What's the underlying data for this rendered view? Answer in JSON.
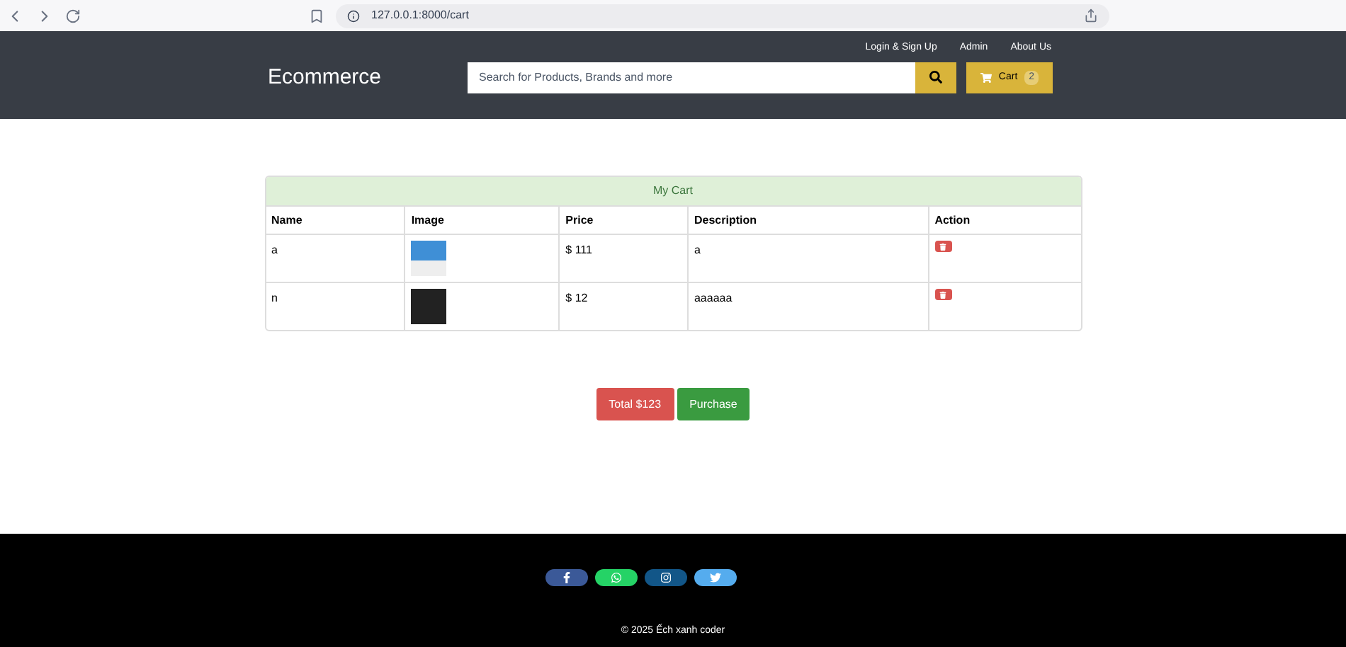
{
  "browser": {
    "url": "127.0.0.1:8000/cart"
  },
  "header": {
    "links": [
      "Login & Sign Up",
      "Admin",
      "About Us"
    ],
    "brand": "Ecommerce",
    "search": {
      "placeholder": "Search for Products, Brands and more"
    },
    "cart": {
      "label": "Cart",
      "count": "2"
    }
  },
  "cart_table": {
    "title": "My Cart",
    "columns": [
      "Name",
      "Image",
      "Price",
      "Description",
      "Action"
    ],
    "rows": [
      {
        "name": "a",
        "kind": "light",
        "price": "$ 111",
        "description": "a"
      },
      {
        "name": "n",
        "kind": "dark",
        "price": "$ 12",
        "description": "aaaaaa"
      }
    ]
  },
  "total": "Total $123",
  "purchase": "Purchase",
  "footer": {
    "social": [
      {
        "kind": "facebook",
        "color": "#3b5998"
      },
      {
        "kind": "whatsapp",
        "color": "#25d366"
      },
      {
        "kind": "instagram",
        "color": "#125688"
      },
      {
        "kind": "twitter",
        "color": "#55acee"
      }
    ],
    "copyright": "© 2025 Ếch xanh coder"
  }
}
